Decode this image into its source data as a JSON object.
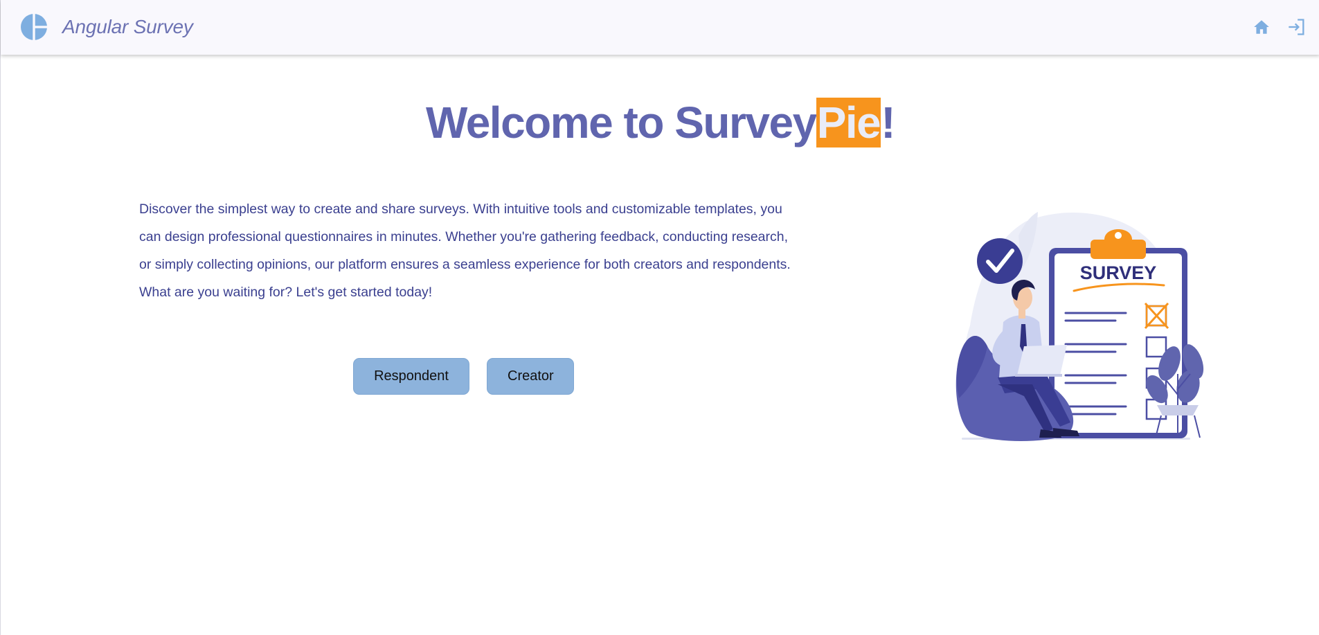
{
  "app": {
    "title": "Angular Survey",
    "logo_icon": "pie-chart-icon",
    "nav": {
      "home_icon": "home-icon",
      "login_icon": "login-icon"
    }
  },
  "hero": {
    "prefix": "Welcome to Survey",
    "highlight": "Pie",
    "suffix": "!"
  },
  "description": "Discover the simplest way to create and share surveys. With intuitive tools and customizable templates, you can design professional questionnaires in minutes. Whether you're gathering feedback, conducting research, or simply collecting opinions, our platform ensures a seamless experience for both creators and respondents. What are you waiting for? Let's get started today!",
  "buttons": {
    "respondent": "Respondent",
    "creator": "Creator"
  },
  "illustration": {
    "clipboard_text": "SURVEY"
  },
  "colors": {
    "brand": "#6065ae",
    "accent": "#f7941d",
    "button": "#8db3dc",
    "icon": "#7eaee0",
    "text": "#3a3f8f"
  }
}
